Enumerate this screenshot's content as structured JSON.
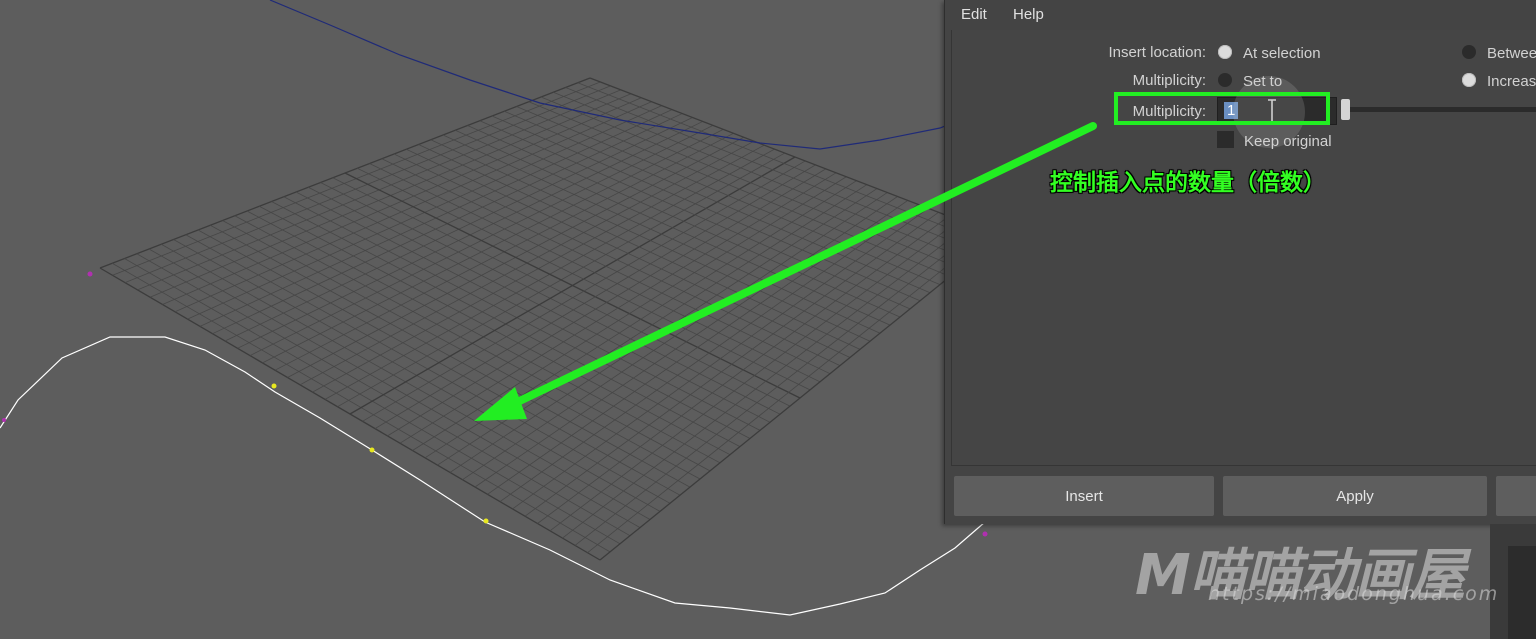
{
  "menu": {
    "edit": "Edit",
    "help": "Help"
  },
  "options": {
    "insert_location_label": "Insert location:",
    "at_selection": "At selection",
    "between": "Betwee",
    "multiplicity_label_1": "Multiplicity:",
    "set_to": "Set to",
    "increase": "Increas",
    "multiplicity_label_2": "Multiplicity:",
    "multiplicity_value": "1",
    "keep_original": "Keep original"
  },
  "annotation": "控制插入点的数量（倍数）",
  "buttons": {
    "insert": "Insert",
    "apply": "Apply"
  },
  "watermark": {
    "brand": "M喵喵动画屋",
    "url": "https://miaodonghua.com"
  },
  "colors": {
    "highlight": "#22ee22",
    "annotation_text": "#33ff22",
    "dialog_bg": "#444444",
    "viewport_bg": "#5d5d5d"
  }
}
